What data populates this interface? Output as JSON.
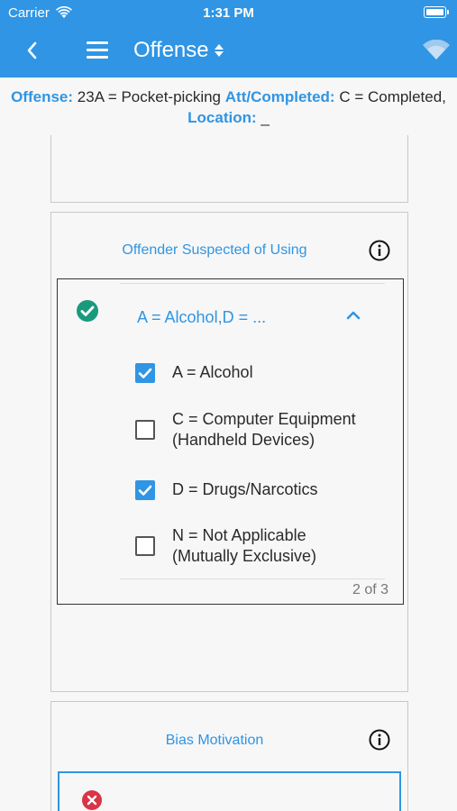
{
  "status_bar": {
    "carrier": "Carrier",
    "time": "1:31 PM"
  },
  "app_bar": {
    "title": "Offense",
    "accent_color": "#2f95e4",
    "icons": [
      "back-icon",
      "menu-icon",
      "sort-icon",
      "signal-icon"
    ]
  },
  "summary": {
    "offense_label": "Offense:",
    "offense_value": "23A = Pocket-picking",
    "att_label": "Att/Completed:",
    "att_value": "C = Completed,",
    "location_label": "Location:",
    "location_value": "_"
  },
  "suspected_using": {
    "title": "Offender Suspected of Using",
    "selected_value": "A = Alcohol,D = ...",
    "options": [
      {
        "label_line1": "A = Alcohol",
        "label_line2": "",
        "checked": true
      },
      {
        "label_line1": "C = Computer Equipment",
        "label_line2": "(Handheld Devices)",
        "checked": false
      },
      {
        "label_line1": "D = Drugs/Narcotics",
        "label_line2": "",
        "checked": true
      },
      {
        "label_line1": "N = Not Applicable",
        "label_line2": "(Mutually Exclusive)",
        "checked": false
      }
    ],
    "pager": "2 of 3"
  },
  "bias_motivation": {
    "title": "Bias Motivation"
  },
  "colors": {
    "ok": "#1a9a7d",
    "error": "#d93447",
    "checkbox_on": "#2f95e4"
  }
}
